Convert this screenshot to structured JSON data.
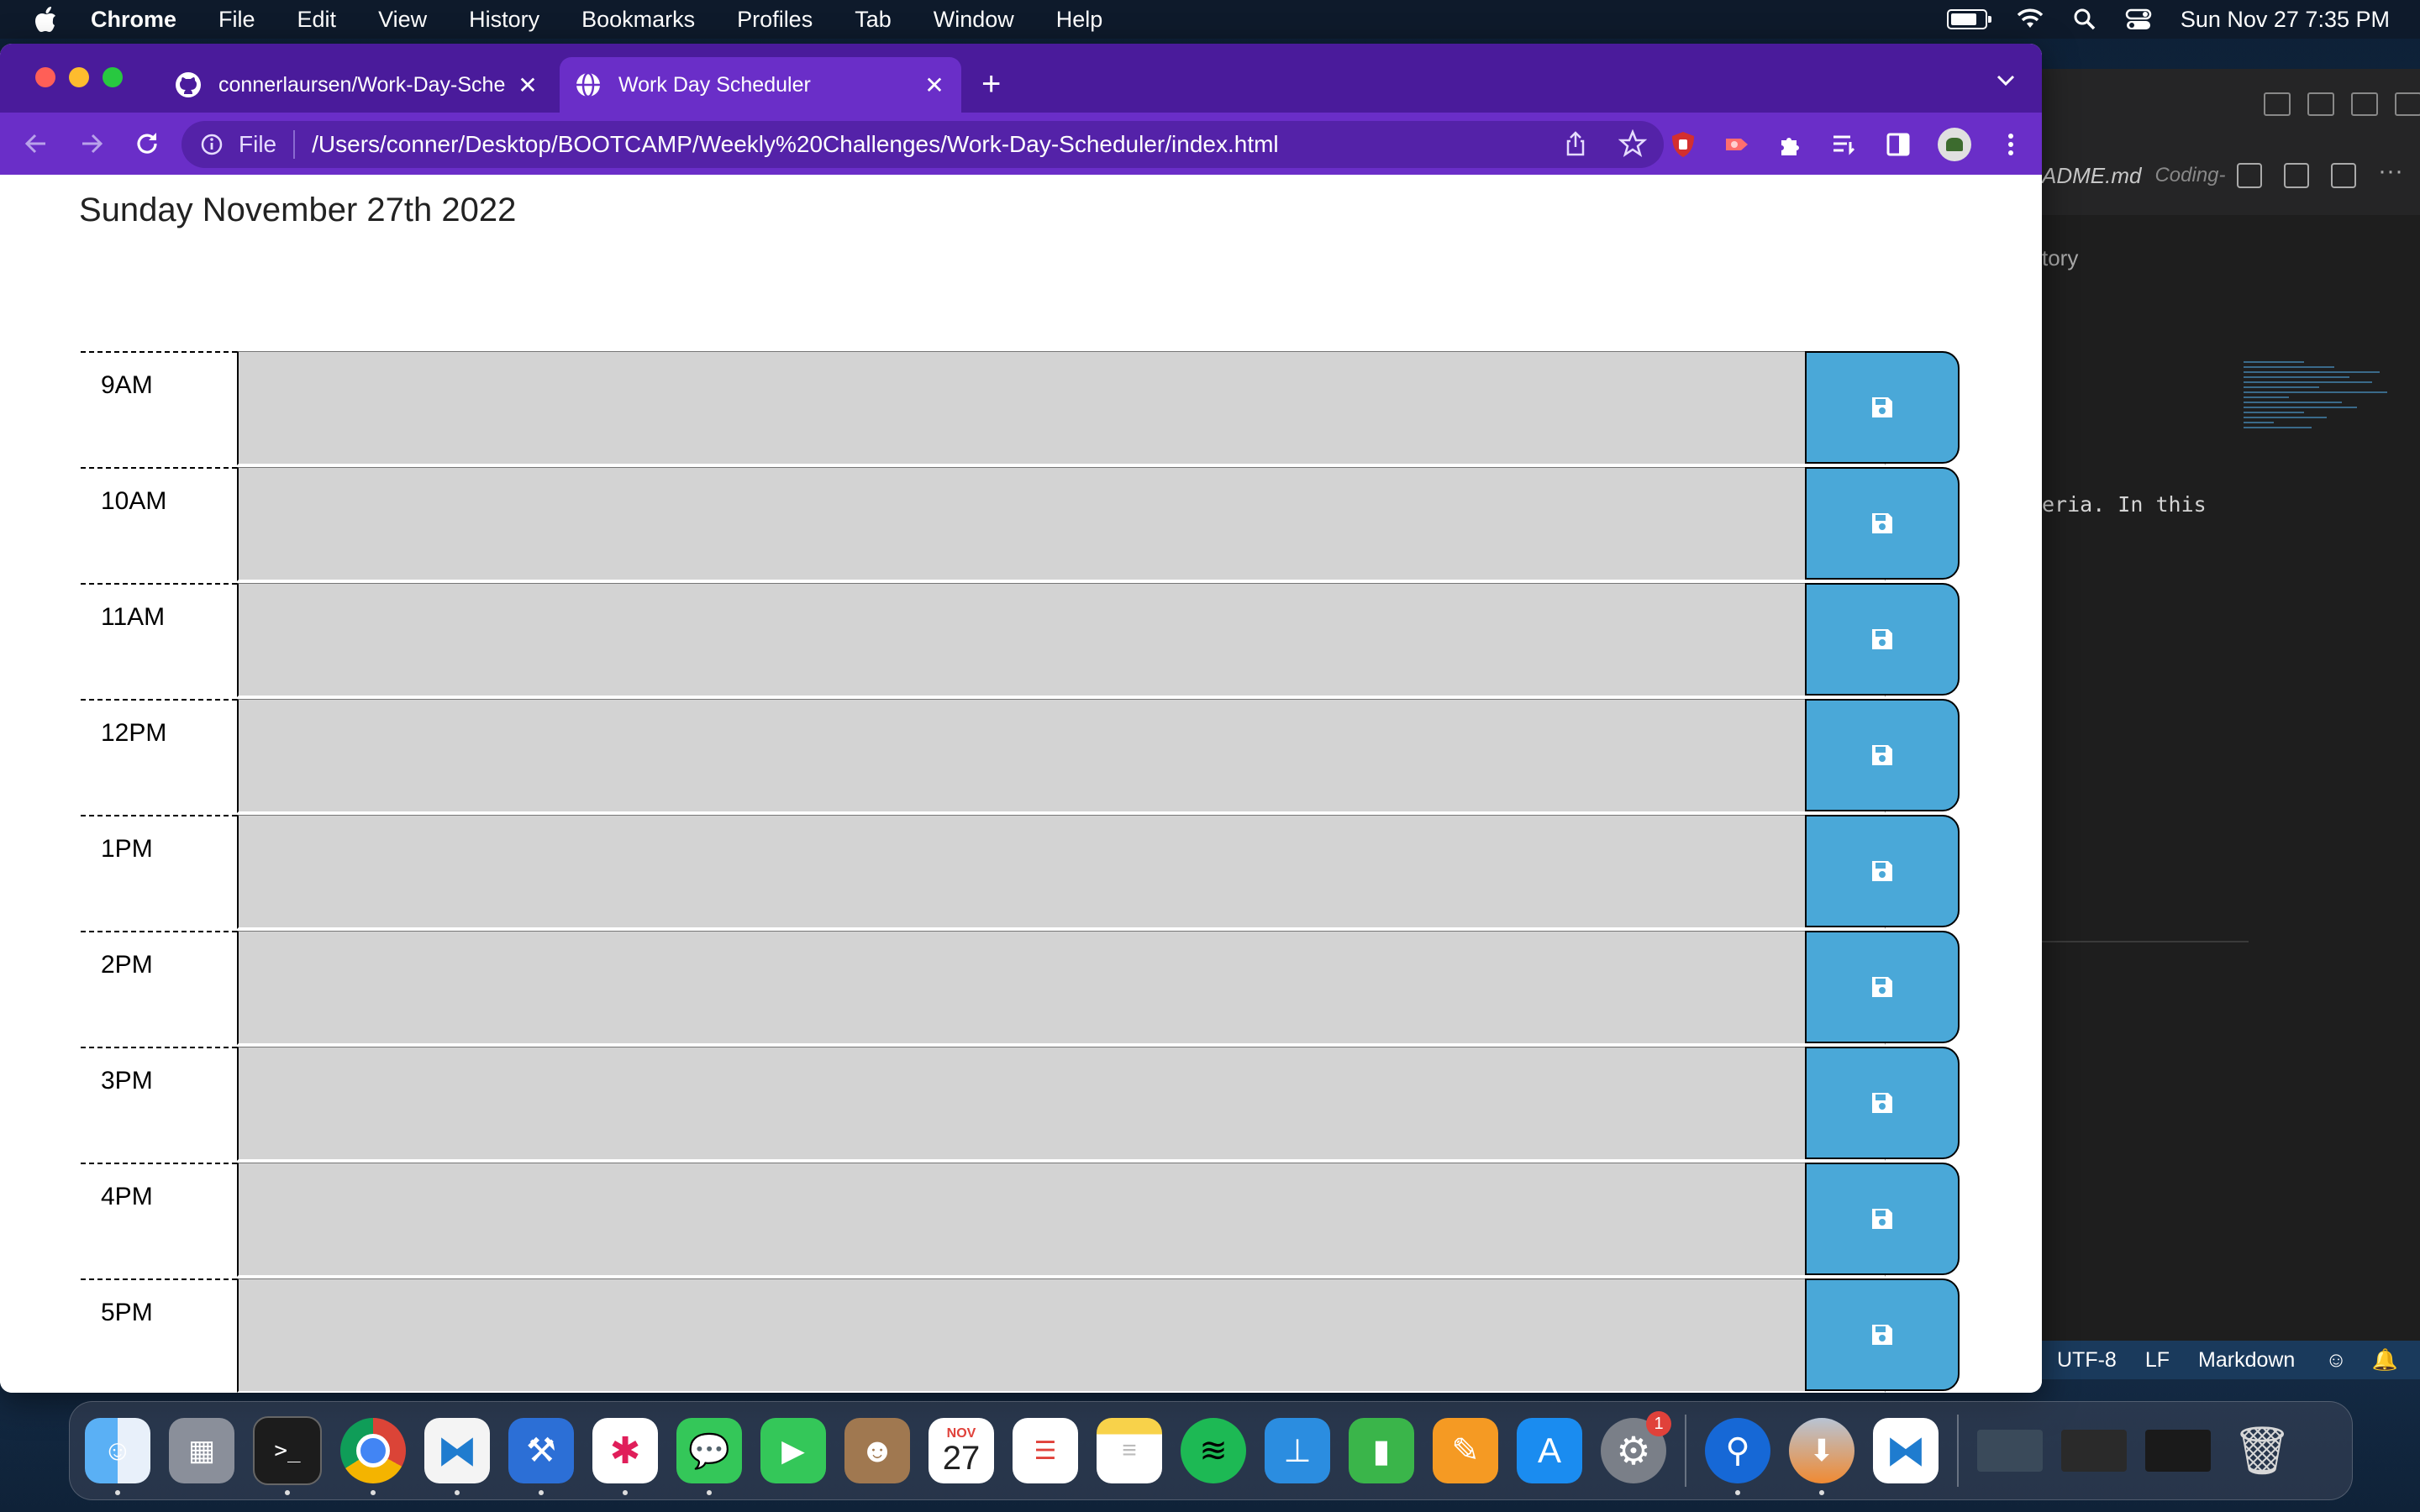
{
  "menubar": {
    "items": [
      "Chrome",
      "File",
      "Edit",
      "View",
      "History",
      "Bookmarks",
      "Profiles",
      "Tab",
      "Window",
      "Help"
    ],
    "clock": "Sun Nov 27  7:35 PM",
    "battery_level": 0.85
  },
  "browser": {
    "tabs": [
      {
        "title": "connerlaursen/Work-Day-Sche",
        "icon": "github-icon",
        "active": false
      },
      {
        "title": "Work Day Scheduler",
        "icon": "globe-icon",
        "active": true
      }
    ],
    "omnibox": {
      "scheme_label": "File",
      "url": "/Users/conner/Desktop/BOOTCAMP/Weekly%20Challenges/Work-Day-Scheduler/index.html"
    }
  },
  "page": {
    "current_day": "Sunday November 27th 2022",
    "rows": [
      {
        "hour": "9AM",
        "text": ""
      },
      {
        "hour": "10AM",
        "text": ""
      },
      {
        "hour": "11AM",
        "text": ""
      },
      {
        "hour": "12PM",
        "text": ""
      },
      {
        "hour": "1PM",
        "text": ""
      },
      {
        "hour": "2PM",
        "text": ""
      },
      {
        "hour": "3PM",
        "text": ""
      },
      {
        "hour": "4PM",
        "text": ""
      },
      {
        "hour": "5PM",
        "text": ""
      }
    ],
    "colors": {
      "past": "#d3d3d3",
      "save": "#4aa8d8"
    }
  },
  "vscode": {
    "tab_name": "ADME.md",
    "tab_path": "Coding-",
    "breadcrumb": "tory",
    "code_fragment": "eria. In this",
    "status": {
      "encoding": "UTF-8",
      "eol": "LF",
      "language": "Markdown"
    }
  },
  "dock": {
    "calendar_month": "NOV",
    "calendar_day": "27",
    "settings_badge": "1"
  }
}
